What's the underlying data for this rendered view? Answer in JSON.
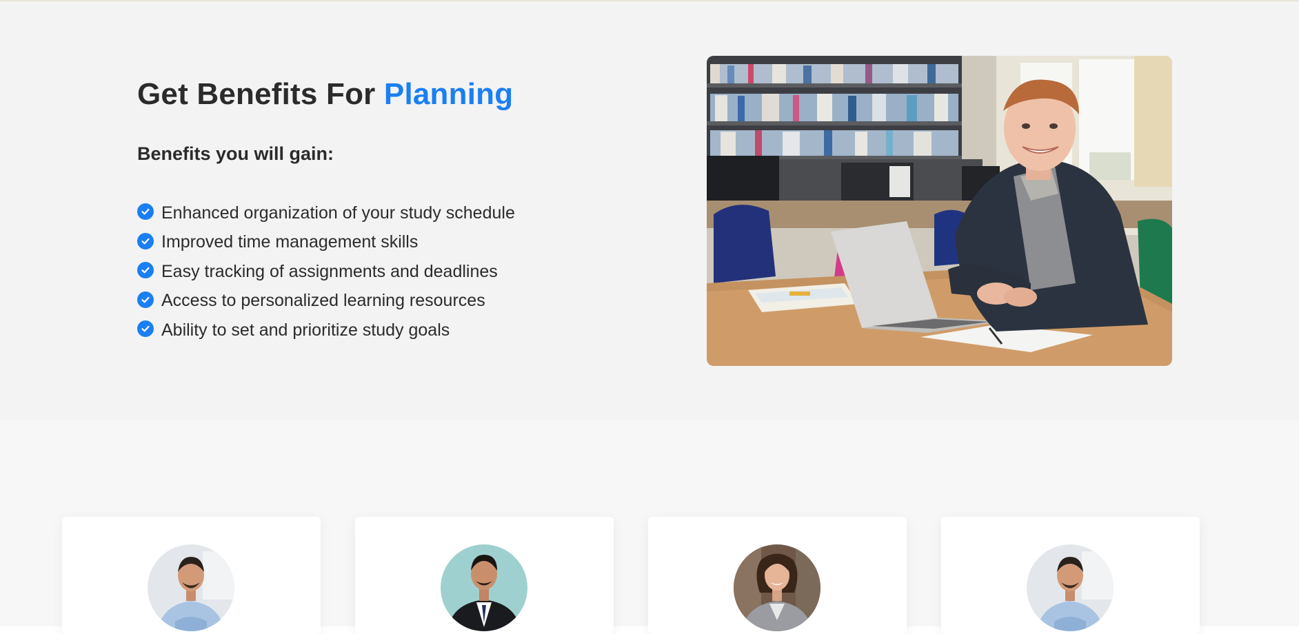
{
  "benefits": {
    "title_prefix": "Get Benefits For ",
    "title_accent": "Planning",
    "subtitle": "Benefits you will gain:",
    "items": [
      "Enhanced organization of your study schedule",
      "Improved time management skills",
      "Easy tracking of assignments and deadlines",
      "Access to personalized learning resources",
      "Ability to set and prioritize study goals"
    ],
    "accent_color": "#1a7ff2",
    "check_icon": "check-circle-icon"
  },
  "hero_image": {
    "subject": "student-with-laptop-in-library-photo"
  },
  "team": {
    "cards": [
      {
        "avatar": "man-light-blue-shirt-photo"
      },
      {
        "avatar": "man-black-suit-photo"
      },
      {
        "avatar": "woman-grey-blazer-photo"
      },
      {
        "avatar": "man-light-blue-shirt-photo"
      }
    ]
  }
}
